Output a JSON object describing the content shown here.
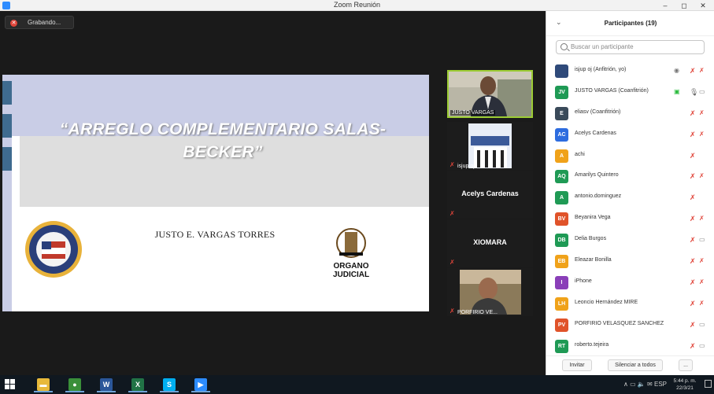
{
  "window": {
    "title": "Zoom Reunión",
    "controls": {
      "minimize": "–",
      "maximize": "◻",
      "close": "✕"
    }
  },
  "recording": {
    "label": "Grabando..."
  },
  "slide": {
    "title_line1": "“ARREGLO COMPLEMENTARIO SALAS-",
    "title_line2": "BECKER”",
    "presenter": "JUSTO E. VARGAS TORRES",
    "logo_right_line1": "ORGANO",
    "logo_right_line2": "JUDICIAL"
  },
  "video_tiles": [
    {
      "label": "JUSTO VARGAS",
      "muted": false,
      "active": true
    },
    {
      "label": "isjup oj",
      "muted": true
    },
    {
      "name": "Acelys Cardenas",
      "muted": true
    },
    {
      "name": "XIOMARA",
      "muted": true
    },
    {
      "label": "PORFIRIO VE...",
      "muted": true
    }
  ],
  "participants_panel": {
    "title": "Participantes (19)",
    "search_placeholder": "Buscar un participante",
    "participants": [
      {
        "initials": "",
        "color": "#2f4a7a",
        "name": "isjup oj (Anfitrión, yo)",
        "mic": "muted",
        "cam": "muted"
      },
      {
        "initials": "JV",
        "color": "#1f9a55",
        "name": "JUSTO VARGAS (Coanfitrión)",
        "mic": "on",
        "cam": "off"
      },
      {
        "initials": "E",
        "color": "#3a4a5a",
        "name": "eliasv (Coanfitrión)",
        "mic": "muted",
        "cam": "muted"
      },
      {
        "initials": "AC",
        "color": "#2d6cdf",
        "name": "Acelys Cardenas",
        "mic": "muted",
        "cam": "muted"
      },
      {
        "initials": "A",
        "color": "#f0a21a",
        "name": "achi",
        "mic": "muted",
        "cam": ""
      },
      {
        "initials": "AQ",
        "color": "#1f9a55",
        "name": "Amarilys Quintero",
        "mic": "muted",
        "cam": "muted"
      },
      {
        "initials": "A",
        "color": "#1f9a55",
        "name": "antonio.dominguez",
        "mic": "muted",
        "cam": ""
      },
      {
        "initials": "BV",
        "color": "#e0532a",
        "name": "Beyanira Vega",
        "mic": "muted",
        "cam": "muted"
      },
      {
        "initials": "DB",
        "color": "#1f9a55",
        "name": "Delia Burgos",
        "mic": "muted",
        "cam": "off"
      },
      {
        "initials": "EB",
        "color": "#f0a21a",
        "name": "Eleazar Bonilla",
        "mic": "muted",
        "cam": "muted"
      },
      {
        "initials": "I",
        "color": "#8a3fb8",
        "name": "iPhone",
        "mic": "muted",
        "cam": "muted"
      },
      {
        "initials": "LH",
        "color": "#f0a21a",
        "name": "Leoncio Hernández MIRE",
        "mic": "muted",
        "cam": "muted"
      },
      {
        "initials": "PV",
        "color": "#e0532a",
        "name": "PORFIRIO VELASQUEZ SANCHEZ",
        "mic": "muted",
        "cam": "off"
      },
      {
        "initials": "RT",
        "color": "#1f9a55",
        "name": "roberto.tejeira",
        "mic": "muted",
        "cam": "off"
      }
    ],
    "footer": {
      "invite": "Invitar",
      "mute_all": "Silenciar a todos",
      "more": "..."
    }
  },
  "taskbar": {
    "apps": [
      {
        "name": "file-explorer",
        "glyph": "▬",
        "color": "#e8b93a"
      },
      {
        "name": "chrome",
        "glyph": "●",
        "color": "#3a8f3a"
      },
      {
        "name": "word",
        "glyph": "W",
        "color": "#2b579a"
      },
      {
        "name": "excel",
        "glyph": "X",
        "color": "#217346"
      },
      {
        "name": "skype",
        "glyph": "S",
        "color": "#00aff0"
      },
      {
        "name": "zoom",
        "glyph": "▶",
        "color": "#2d8cff"
      }
    ],
    "tray": "∧ ▭ 🔈 ✉ ESP",
    "time": "5:44 p. m.",
    "date": "22/3/21"
  }
}
